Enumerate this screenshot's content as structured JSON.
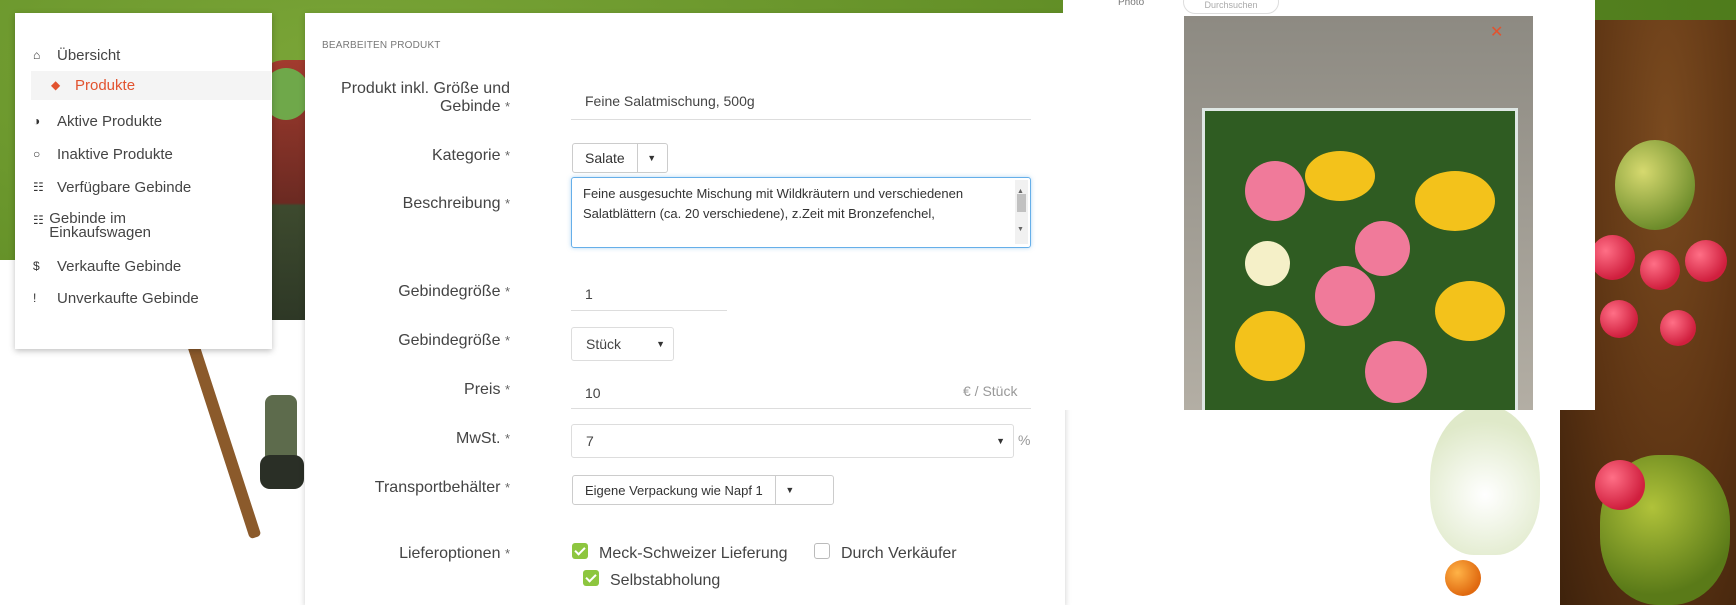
{
  "sidebar": {
    "items": [
      {
        "label": "Übersicht",
        "icon": "home-icon",
        "glyph": "⌂",
        "active": false
      },
      {
        "label": "Produkte",
        "icon": "tags-icon",
        "glyph": "◆",
        "active": true
      },
      {
        "label": "Aktive Produkte",
        "icon": "toggle-on-icon",
        "glyph": "◑",
        "active": false
      },
      {
        "label": "Inaktive Produkte",
        "icon": "toggle-off-icon",
        "glyph": "○",
        "active": false
      },
      {
        "label": "Verfügbare Gebinde",
        "icon": "cart-icon",
        "glyph": "☷",
        "active": false
      },
      {
        "label": "Gebinde im Einkaufswagen",
        "icon": "cart-icon",
        "glyph": "☷",
        "active": false
      },
      {
        "label": "Verkaufte Gebinde",
        "icon": "dollar-icon",
        "glyph": "$",
        "active": false
      },
      {
        "label": "Unverkaufte Gebinde",
        "icon": "exclamation-icon",
        "glyph": "!",
        "active": false
      }
    ]
  },
  "form": {
    "title": "BEARBEITEN PRODUKT",
    "required_mark": "*",
    "product_name": {
      "label": "Produkt inkl. Größe und Gebinde",
      "value": "Feine Salatmischung, 500g"
    },
    "category": {
      "label": "Kategorie",
      "value": "Salate"
    },
    "description": {
      "label": "Beschreibung",
      "value": "Feine ausgesuchte Mischung mit Wildkräutern und verschiedenen Salatblättern (ca. 20 verschiedene), z.Zeit mit Bronzefenchel,"
    },
    "unit_size": {
      "label": "Gebindegröße",
      "value": "1"
    },
    "unit_type": {
      "label": "Gebindegröße",
      "value": "Stück"
    },
    "price": {
      "label": "Preis",
      "value": "10",
      "unit": "€ / Stück"
    },
    "vat": {
      "label": "MwSt.",
      "value": "7",
      "unit": "%"
    },
    "container": {
      "label": "Transportbehälter",
      "value": "Eigene Verpackung wie Napf 1"
    },
    "delivery": {
      "label": "Lieferoptionen",
      "options": [
        {
          "label": "Meck-Schweizer Lieferung",
          "checked": true
        },
        {
          "label": "Durch Verkäufer",
          "checked": false
        },
        {
          "label": "Selbstabholung",
          "checked": true
        }
      ]
    }
  },
  "photo": {
    "label": "Photo",
    "browse_label": "Durchsuchen",
    "close_icon": "close-icon"
  },
  "colors": {
    "accent": "#e2532f",
    "checkbox": "#8dc63f",
    "focus": "#66afe9",
    "background_green": "#5e8a24"
  }
}
